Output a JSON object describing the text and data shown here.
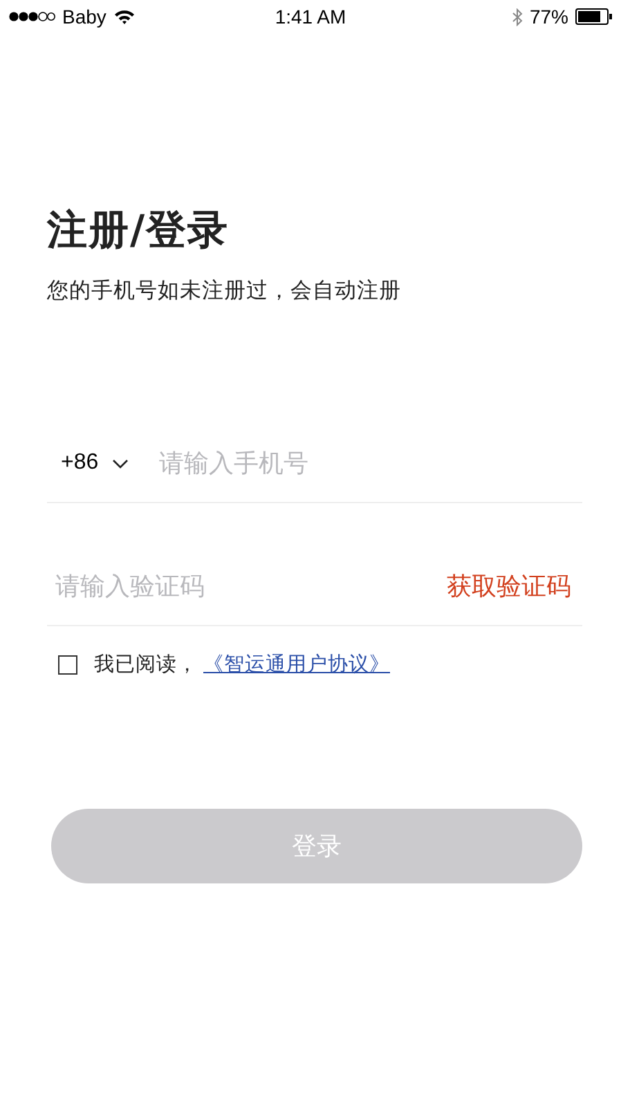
{
  "status_bar": {
    "carrier": "Baby",
    "time": "1:41 AM",
    "battery": "77%"
  },
  "title": "注册/登录",
  "subtitle": "您的手机号如未注册过，会自动注册",
  "phone": {
    "country_code": "+86",
    "placeholder": "请输入手机号"
  },
  "code": {
    "placeholder": "请输入验证码",
    "action": "获取验证码"
  },
  "agreement": {
    "checked": false,
    "text": "我已阅读，",
    "link": "《智运通用户协议》"
  },
  "login_button": {
    "label": "登录",
    "disabled": true
  }
}
